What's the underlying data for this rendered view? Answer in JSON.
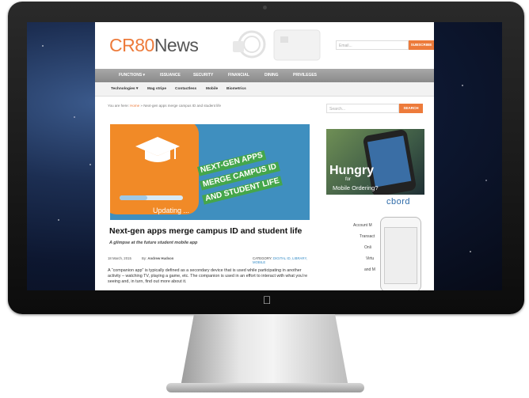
{
  "site": {
    "logo_brand": "CR80",
    "logo_rest": "News",
    "email_placeholder": "Email...",
    "subscribe": "SUBSCRIBE"
  },
  "nav": {
    "items": [
      "FUNCTIONS ▾",
      "ISSUANCE",
      "SECURITY",
      "FINANCIAL",
      "DINING",
      "PRIVILEGES"
    ]
  },
  "subnav": {
    "items": [
      "Technologies ▾",
      "Mag stripe",
      "Contactless",
      "Mobile",
      "Biometrics"
    ]
  },
  "breadcrumb": {
    "prefix": "You are here:",
    "home": "Home",
    "sep": "»",
    "current": "Next-gen apps merge campus ID and student life"
  },
  "hero": {
    "banner": [
      "NEXT-GEN APPS",
      "MERGE CAMPUS ID",
      "AND STUDENT LIFE"
    ],
    "status": "Updating ..."
  },
  "article": {
    "title": "Next-gen apps merge campus ID and student life",
    "subtitle": "A glimpse at the future student mobile app",
    "date": "18 March, 2015",
    "by_label": "By:",
    "author": "Andrew Hudson",
    "category_label": "CATEGORY:",
    "categories": "DIGITAL ID, LIBRARY, MOBILE",
    "body": "A “companion app” is typically defined as a secondary device that is used while participating in another activity – watching TV, playing a game, etc. The companion is used in an effort to interact with what you’re seeing and, in turn, find out more about it."
  },
  "sidebar": {
    "search_placeholder": "Search...",
    "search_button": "SEARCH",
    "ad_headline": "Hungry",
    "ad_for": "for",
    "ad_line": "Mobile Ordering?",
    "ad_brand": "cbord",
    "ad2_lines": [
      "Account M",
      "Transact",
      "Onli",
      "Virtu",
      "and M"
    ]
  },
  "colors": {
    "accent": "#ed7b3b",
    "nav_bg": "#999999",
    "banner_green": "#45a64b",
    "link_blue": "#3a8fc8"
  }
}
